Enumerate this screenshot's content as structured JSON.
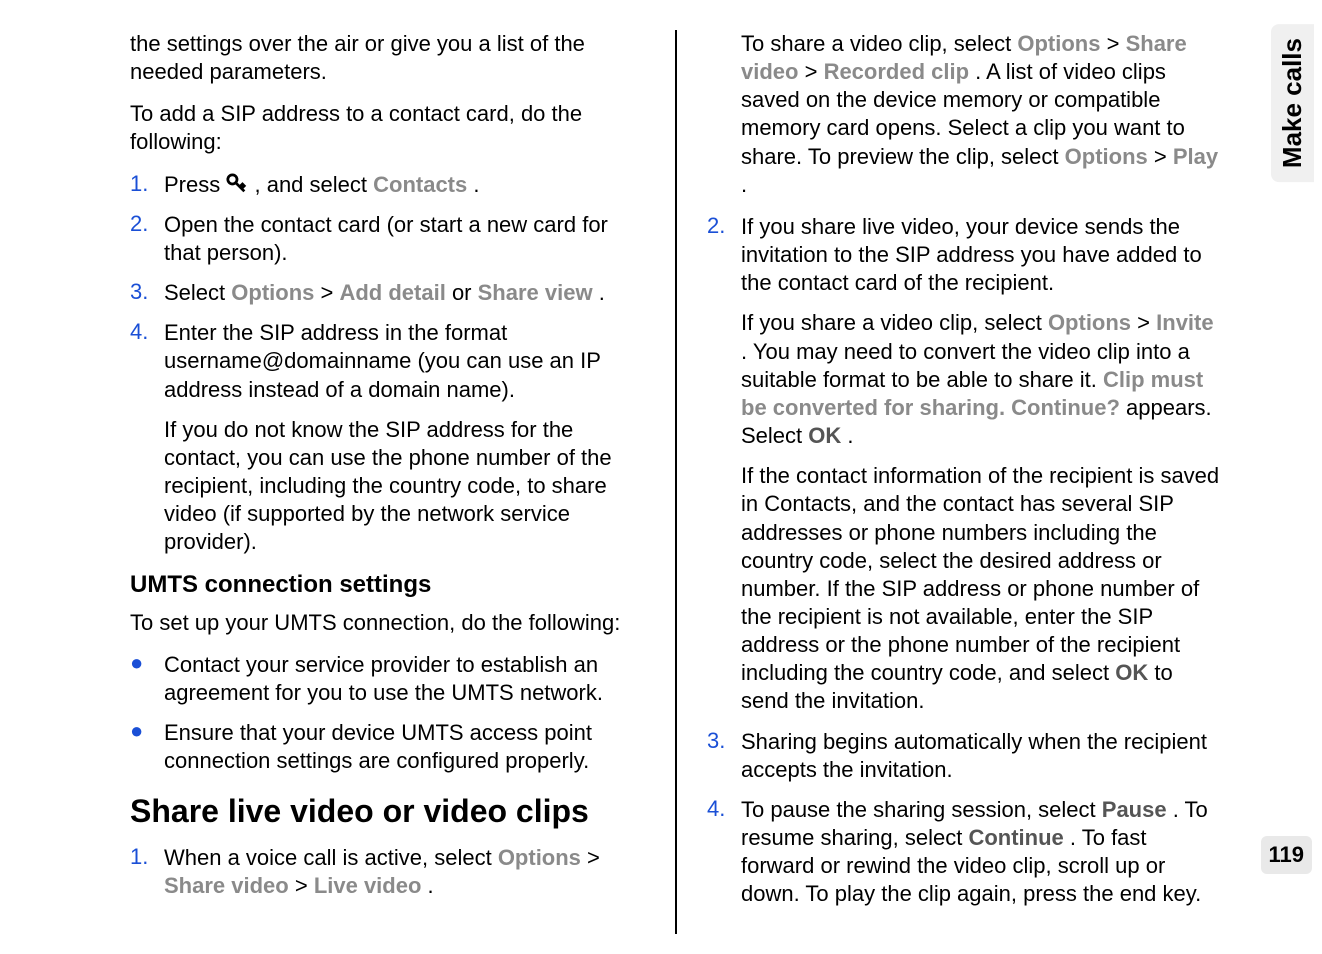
{
  "sidebar": {
    "tab_label": "Make calls"
  },
  "page_number": "119",
  "left": {
    "para1": "the settings over the air or give you a list of the needed parameters.",
    "para2": "To add a SIP address to a contact card, do the following:",
    "ol": [
      {
        "num": "1.",
        "pre": "Press ",
        "post1": ", and select ",
        "ui_contacts": "Contacts",
        "post2": "."
      },
      {
        "num": "2.",
        "text": "Open the contact card (or start a new card for that person)."
      },
      {
        "num": "3.",
        "pre": "Select ",
        "ui_options": "Options",
        "gt": " > ",
        "ui_add_detail": "Add detail",
        "or": " or ",
        "ui_share_view": "Share view",
        "post": "."
      },
      {
        "num": "4.",
        "text": "Enter the SIP address in the format username@domainname (you can use an IP address instead of a domain name).",
        "sub": "If you do not know the SIP address for the contact, you can use the phone number of the recipient, including the country code, to share video (if supported by the network service provider)."
      }
    ],
    "h3": "UMTS connection settings",
    "para3": "To set up your UMTS connection, do the following:",
    "ul": [
      "Contact your service provider to establish an agreement for you to use the UMTS network.",
      "Ensure that your device UMTS access point connection settings are configured properly."
    ],
    "h2": "Share live video or video clips",
    "ol2_num": "1.",
    "ol2_pre": "When a voice call is active, select ",
    "ol2_ui_options": "Options",
    "ol2_gt1": " > ",
    "ol2_ui_share_video": "Share video",
    "ol2_gt2": " > ",
    "ol2_ui_live_video": "Live video",
    "ol2_post": "."
  },
  "right": {
    "p1_pre": "To share a video clip, select ",
    "p1_ui_options": "Options",
    "p1_gt1": " > ",
    "p1_ui_share_video": "Share video",
    "p1_gt2": " > ",
    "p1_ui_recorded_clip": "Recorded clip",
    "p1_mid": ". A list of video clips saved on the device memory or compatible memory card opens. Select a clip you want to share. To preview the clip, select ",
    "p1_ui_options2": "Options",
    "p1_gt3": " > ",
    "p1_ui_play": "Play",
    "p1_post": ".",
    "ol": [
      {
        "num": "2.",
        "text": "If you share live video, your device sends the invitation to the SIP address you have added to the contact card of the recipient.",
        "sub1_pre": "If you share a video clip, select ",
        "sub1_ui_options": "Options",
        "sub1_gt": " > ",
        "sub1_ui_invite": "Invite",
        "sub1_mid": ". You may need to convert the video clip into a suitable format to be able to share it. ",
        "sub1_ui_warn": "Clip must be converted for sharing. Continue?",
        "sub1_mid2": " appears. Select ",
        "sub1_ui_ok": "OK",
        "sub1_post": ".",
        "sub2_pre": "If the contact information of the recipient is saved in Contacts, and the contact has several SIP addresses or phone numbers including the country code, select the desired address or number. If the SIP address or phone number of the recipient is not available, enter the SIP address or the phone number of the recipient including the country code, and select ",
        "sub2_ui_ok": "OK",
        "sub2_post": " to send the invitation."
      },
      {
        "num": "3.",
        "text": "Sharing begins automatically when the recipient accepts the invitation."
      },
      {
        "num": "4.",
        "pre": "To pause the sharing session, select ",
        "ui_pause": "Pause",
        "mid1": ". To resume sharing, select ",
        "ui_continue": "Continue",
        "post": ". To fast forward or rewind the video clip, scroll up or down. To play the clip again, press the end key."
      }
    ]
  }
}
